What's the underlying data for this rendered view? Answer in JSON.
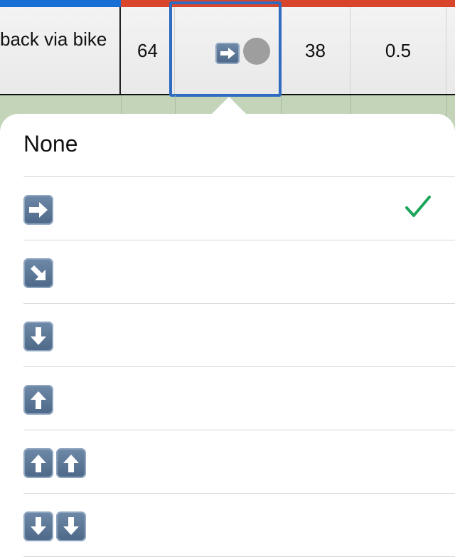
{
  "row": {
    "name_fragment": "back via bike",
    "col_value_1": "64",
    "col_value_2": "38",
    "col_value_3": "0.5",
    "selected_trend_icon": "right-arrow-icon",
    "status_dot_color": "#9e9e9e"
  },
  "popover": {
    "options": [
      {
        "label": "None",
        "icon": "none"
      },
      {
        "icon": "right-arrow-icon",
        "selected": true
      },
      {
        "icon": "down-right-arrow-icon"
      },
      {
        "icon": "down-arrow-icon"
      },
      {
        "icon": "up-arrow-icon"
      },
      {
        "icon": "double-up-arrow-icon"
      },
      {
        "icon": "double-down-arrow-icon"
      }
    ],
    "checkmark_color": "#1aa55a"
  },
  "colors": {
    "header_blue": "#1a6fd6",
    "header_red": "#d9452c",
    "selection_border": "#2f6bc0",
    "sheet_background": "#c3d4b9"
  }
}
